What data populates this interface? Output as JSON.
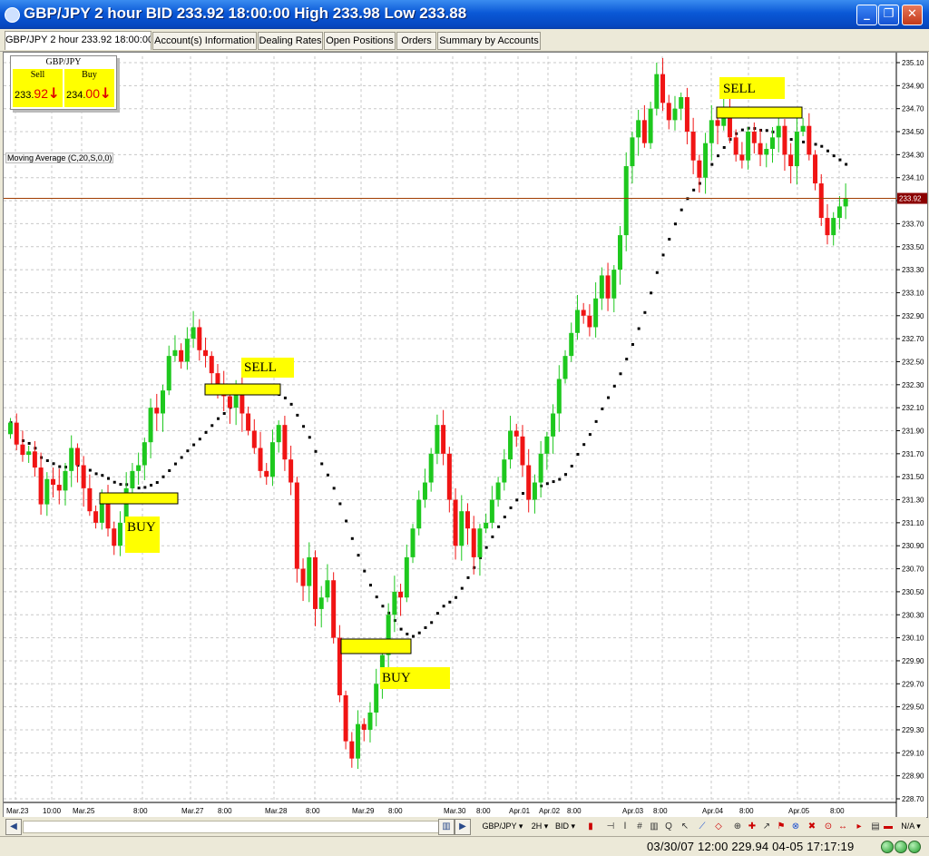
{
  "window": {
    "title": "GBP/JPY 2 hour BID 233.92 18:00:00 High 233.98 Low 233.88",
    "controls": {
      "minimize": "_",
      "maximize": "❐",
      "close": "✕"
    }
  },
  "tabs": [
    {
      "label": "GBP/JPY 2 hour 233.92 18:00:00",
      "active": true
    },
    {
      "label": "Account(s) Information"
    },
    {
      "label": "Dealing Rates"
    },
    {
      "label": "Open Positions"
    },
    {
      "label": "Orders"
    },
    {
      "label": "Summary by Accounts"
    }
  ],
  "quote": {
    "symbol": "GBP/JPY",
    "sell_label": "Sell",
    "sell_int": "233.",
    "sell_frac": "92",
    "buy_label": "Buy",
    "buy_int": "234.",
    "buy_frac": "00",
    "arrow": "↓"
  },
  "indicator_label": "Moving Average (C,20,S,0,0)",
  "current_price_tag": "233.92",
  "chart_data": {
    "type": "candlestick",
    "instrument": "GBP/JPY",
    "timeframe": "2 hour",
    "ylim": [
      228.7,
      235.15
    ],
    "yticks": [
      "235.10",
      "234.90",
      "234.70",
      "234.50",
      "234.30",
      "234.10",
      "233.90",
      "233.70",
      "233.50",
      "233.30",
      "233.10",
      "232.90",
      "232.70",
      "232.50",
      "232.30",
      "232.10",
      "231.90",
      "231.70",
      "231.50",
      "231.30",
      "231.10",
      "230.90",
      "230.70",
      "230.50",
      "230.30",
      "230.10",
      "229.90",
      "229.70",
      "229.50",
      "229.30",
      "229.10",
      "228.90",
      "228.70"
    ],
    "xticks": [
      "Mar.23",
      "10:00",
      "Mar.25",
      "8:00",
      "Mar.27",
      "8:00",
      "Mar.28",
      "8:00",
      "Mar.29",
      "8:00",
      "Mar.30",
      "8:00",
      "Apr.01",
      "Apr.02",
      "8:00",
      "Apr.03",
      "8:00",
      "Apr.04",
      "8:00",
      "Apr.05",
      "8:00"
    ],
    "current_price": 233.92,
    "bull_color": "#1ec81e",
    "bear_color": "#f01414",
    "ma_color": "#000000",
    "closes": [
      231.97,
      231.78,
      231.69,
      231.72,
      231.58,
      231.26,
      231.48,
      231.43,
      231.38,
      231.55,
      231.75,
      231.6,
      231.4,
      231.2,
      231.1,
      231.3,
      231.05,
      230.9,
      231.1,
      231.4,
      231.55,
      231.6,
      231.8,
      232.1,
      232.05,
      232.25,
      232.55,
      232.6,
      232.5,
      232.7,
      232.8,
      232.6,
      232.55,
      232.4,
      232.3,
      232.2,
      232.1,
      232.25,
      232.05,
      231.9,
      231.75,
      231.55,
      231.5,
      231.8,
      231.95,
      231.65,
      231.45,
      230.7,
      230.55,
      230.8,
      230.35,
      230.45,
      230.6,
      230.1,
      229.6,
      229.2,
      229.05,
      229.35,
      229.3,
      229.45,
      229.7,
      229.95,
      230.3,
      230.5,
      230.45,
      230.8,
      231.05,
      231.3,
      231.45,
      231.7,
      231.95,
      231.7,
      231.3,
      230.9,
      231.2,
      231.05,
      230.8,
      231.05,
      231.1,
      231.3,
      231.45,
      231.65,
      231.9,
      231.85,
      231.6,
      231.3,
      231.45,
      231.7,
      231.85,
      232.05,
      232.35,
      232.55,
      232.75,
      232.95,
      232.9,
      232.8,
      233.05,
      233.25,
      233.05,
      233.3,
      233.6,
      234.2,
      234.45,
      234.6,
      234.4,
      234.7,
      235.0,
      234.75,
      234.6,
      234.7,
      234.8,
      234.5,
      234.25,
      234.1,
      234.4,
      234.6,
      234.55,
      234.7,
      234.45,
      234.3,
      234.25,
      234.5,
      234.4,
      234.3,
      234.35,
      234.45,
      234.55,
      234.3,
      234.2,
      234.5,
      234.55,
      234.3,
      234.05,
      233.75,
      233.6,
      233.75,
      233.85,
      233.92
    ]
  },
  "annotations": [
    {
      "label": "BUY"
    },
    {
      "label": "SELL"
    },
    {
      "label": "BUY"
    },
    {
      "label": "SELL"
    }
  ],
  "toolbar": {
    "symbol_select": "GBP/JPY",
    "period_select": "2H",
    "price_select": "BID",
    "na_select": "N/A"
  },
  "status": {
    "text": "03/30/07 12:00   229.94   04-05 17:17:19"
  }
}
